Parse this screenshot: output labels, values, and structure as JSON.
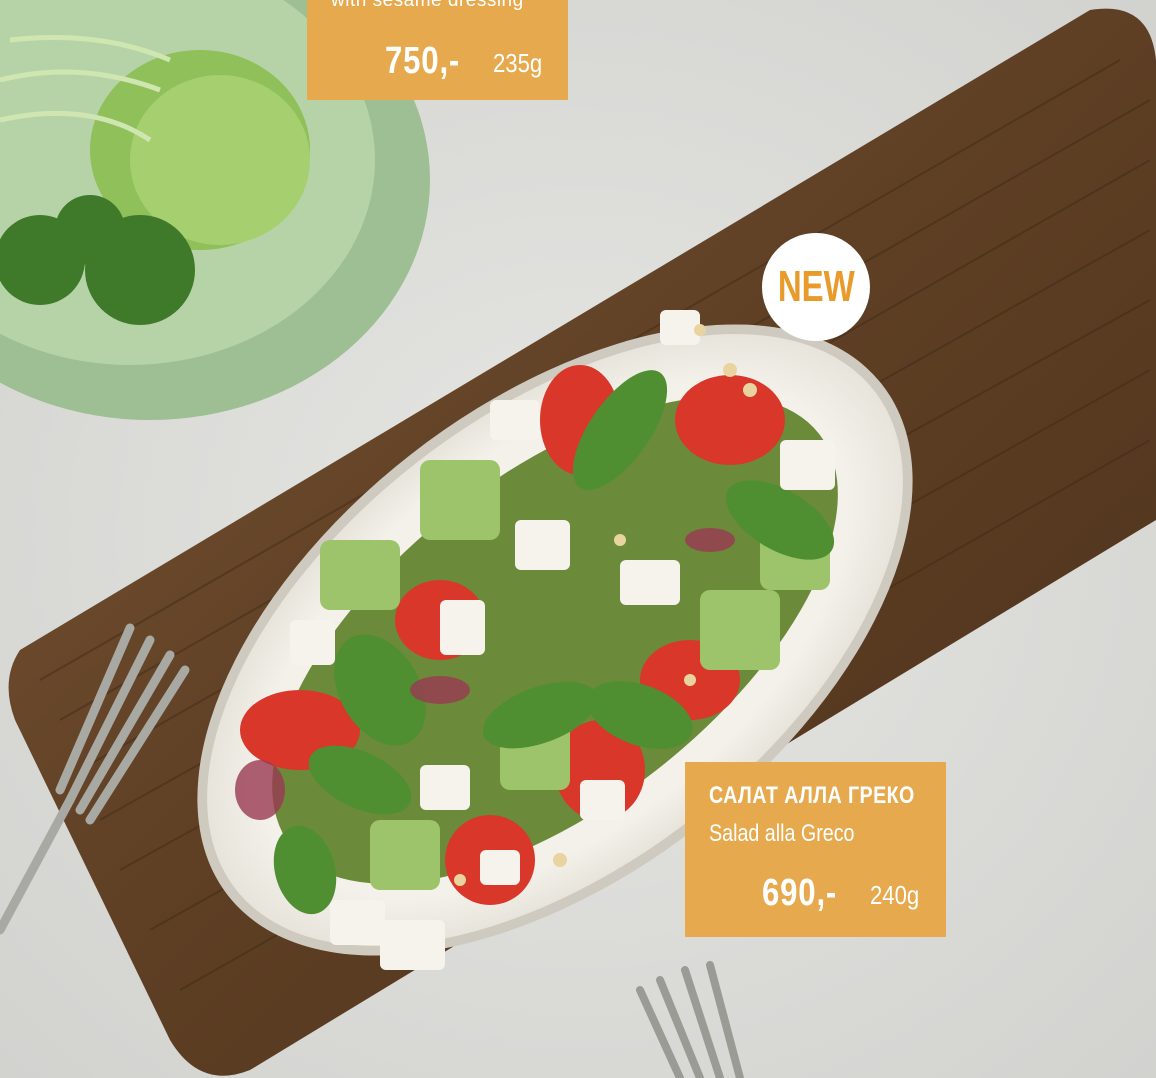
{
  "salad_top": {
    "subtitle": "with sesame dressing",
    "price": "750,-",
    "weight": "235g"
  },
  "badge": {
    "label": "NEW"
  },
  "salad_main": {
    "title_ru": "САЛАТ АЛЛА ГРЕКО",
    "title_en": "Salad alla Greco",
    "price": "690,-",
    "weight": "240g"
  },
  "colors": {
    "card": "#e7a94d",
    "badge_text": "#e89a2a",
    "tablecloth": "#dcdcd9",
    "board": "#6b4a2c"
  }
}
